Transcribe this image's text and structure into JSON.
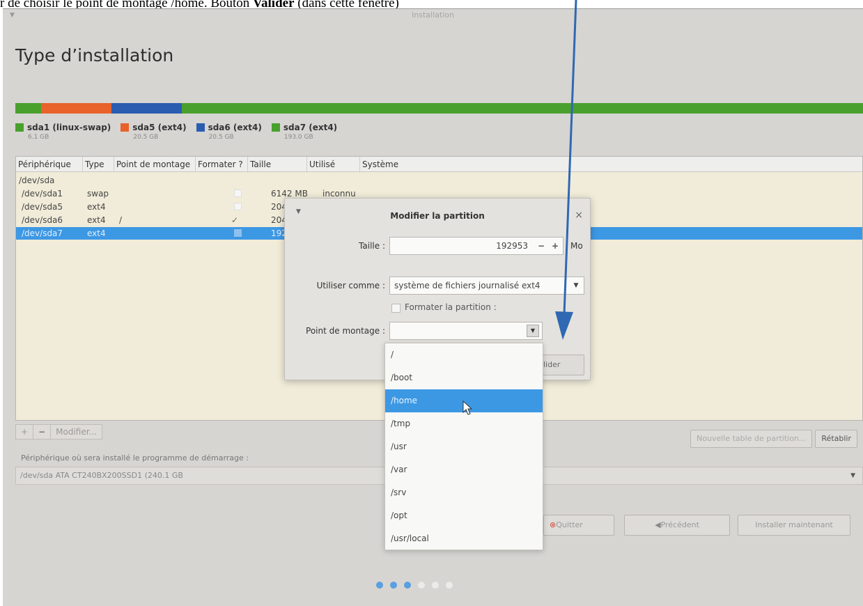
{
  "caption": {
    "prefix": "r de choisir le point de montage /home. Bouton ",
    "bold": "Valider",
    "suffix": " (dans cette fenêtre)"
  },
  "window": {
    "title": "Installation"
  },
  "page_title": "Type d’installation",
  "partition_bar": [
    {
      "name": "sda1",
      "fraction": 0.03,
      "color": "#4aa02c"
    },
    {
      "name": "sda5",
      "fraction": 0.083,
      "color": "#e9622a"
    },
    {
      "name": "sda6",
      "fraction": 0.083,
      "color": "#2a5db0"
    },
    {
      "name": "sda7",
      "fraction": 0.804,
      "color": "#4aa02c"
    }
  ],
  "legend": [
    {
      "label": "sda1 (linux-swap)",
      "size": "6.1 GB",
      "color": "#4aa02c"
    },
    {
      "label": "sda5 (ext4)",
      "size": "20.5 GB",
      "color": "#e9622a"
    },
    {
      "label": "sda6 (ext4)",
      "size": "20.5 GB",
      "color": "#2a5db0"
    },
    {
      "label": "sda7 (ext4)",
      "size": "193.0 GB",
      "color": "#4aa02c"
    }
  ],
  "table": {
    "headers": [
      "Périphérique",
      "Type",
      "Point de montage",
      "Formater ?",
      "Taille",
      "Utilisé",
      "Système"
    ],
    "rows": [
      {
        "device": "/dev/sda",
        "type": "",
        "mount": "",
        "format": "",
        "size": "",
        "used": ""
      },
      {
        "device": "/dev/sda1",
        "type": "swap",
        "mount": "",
        "format": "box",
        "size": "6142 MB",
        "used": "inconnu"
      },
      {
        "device": "/dev/sda5",
        "type": "ext4",
        "mount": "",
        "format": "box",
        "size": "204",
        "used": ""
      },
      {
        "device": "/dev/sda6",
        "type": "ext4",
        "mount": "/",
        "format": "✓",
        "size": "204",
        "used": ""
      },
      {
        "device": "/dev/sda7",
        "type": "ext4",
        "mount": "",
        "format": "box",
        "size": "192",
        "used": ""
      }
    ]
  },
  "toolbar": {
    "add": "+",
    "remove": "−",
    "modify": "Modifier..."
  },
  "right_tools": {
    "new_table": "Nouvelle table de partition...",
    "revert": "Rétablir"
  },
  "boot": {
    "label": "Périphérique où sera installé le programme de démarrage :",
    "value": "/dev/sda   ATA CT240BX200SSD1 (240.1 GB"
  },
  "nav": {
    "quit": "Quitter",
    "back": "Précédent",
    "install": "Installer maintenant"
  },
  "dialog": {
    "title": "Modifier la partition",
    "size_label": "Taille :",
    "size_value": "192953",
    "size_unit": "Mo",
    "use_label": "Utiliser comme :",
    "use_value": "système de fichiers journalisé ext4",
    "format_label": "Formater la partition :",
    "mount_label": "Point de montage :",
    "mount_value": "",
    "ok_partial": "lider"
  },
  "mount_options": [
    "/",
    "/boot",
    "/home",
    "/tmp",
    "/usr",
    "/var",
    "/srv",
    "/opt",
    "/usr/local"
  ],
  "mount_highlight_index": 2,
  "progress_dots": {
    "total": 6,
    "done": 3,
    "active_color": "#5a9fe0",
    "inactive_color": "#ecebea"
  },
  "colors": {
    "selection": "#3d98e4",
    "arrow": "#2f68b3"
  }
}
